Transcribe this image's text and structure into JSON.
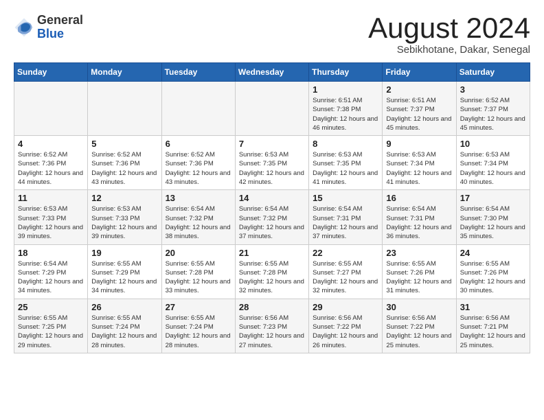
{
  "logo": {
    "general": "General",
    "blue": "Blue"
  },
  "header": {
    "month": "August 2024",
    "location": "Sebikhotane, Dakar, Senegal"
  },
  "weekdays": [
    "Sunday",
    "Monday",
    "Tuesday",
    "Wednesday",
    "Thursday",
    "Friday",
    "Saturday"
  ],
  "weeks": [
    [
      {
        "day": "",
        "info": ""
      },
      {
        "day": "",
        "info": ""
      },
      {
        "day": "",
        "info": ""
      },
      {
        "day": "",
        "info": ""
      },
      {
        "day": "1",
        "info": "Sunrise: 6:51 AM\nSunset: 7:38 PM\nDaylight: 12 hours and 46 minutes."
      },
      {
        "day": "2",
        "info": "Sunrise: 6:51 AM\nSunset: 7:37 PM\nDaylight: 12 hours and 45 minutes."
      },
      {
        "day": "3",
        "info": "Sunrise: 6:52 AM\nSunset: 7:37 PM\nDaylight: 12 hours and 45 minutes."
      }
    ],
    [
      {
        "day": "4",
        "info": "Sunrise: 6:52 AM\nSunset: 7:36 PM\nDaylight: 12 hours and 44 minutes."
      },
      {
        "day": "5",
        "info": "Sunrise: 6:52 AM\nSunset: 7:36 PM\nDaylight: 12 hours and 43 minutes."
      },
      {
        "day": "6",
        "info": "Sunrise: 6:52 AM\nSunset: 7:36 PM\nDaylight: 12 hours and 43 minutes."
      },
      {
        "day": "7",
        "info": "Sunrise: 6:53 AM\nSunset: 7:35 PM\nDaylight: 12 hours and 42 minutes."
      },
      {
        "day": "8",
        "info": "Sunrise: 6:53 AM\nSunset: 7:35 PM\nDaylight: 12 hours and 41 minutes."
      },
      {
        "day": "9",
        "info": "Sunrise: 6:53 AM\nSunset: 7:34 PM\nDaylight: 12 hours and 41 minutes."
      },
      {
        "day": "10",
        "info": "Sunrise: 6:53 AM\nSunset: 7:34 PM\nDaylight: 12 hours and 40 minutes."
      }
    ],
    [
      {
        "day": "11",
        "info": "Sunrise: 6:53 AM\nSunset: 7:33 PM\nDaylight: 12 hours and 39 minutes."
      },
      {
        "day": "12",
        "info": "Sunrise: 6:53 AM\nSunset: 7:33 PM\nDaylight: 12 hours and 39 minutes."
      },
      {
        "day": "13",
        "info": "Sunrise: 6:54 AM\nSunset: 7:32 PM\nDaylight: 12 hours and 38 minutes."
      },
      {
        "day": "14",
        "info": "Sunrise: 6:54 AM\nSunset: 7:32 PM\nDaylight: 12 hours and 37 minutes."
      },
      {
        "day": "15",
        "info": "Sunrise: 6:54 AM\nSunset: 7:31 PM\nDaylight: 12 hours and 37 minutes."
      },
      {
        "day": "16",
        "info": "Sunrise: 6:54 AM\nSunset: 7:31 PM\nDaylight: 12 hours and 36 minutes."
      },
      {
        "day": "17",
        "info": "Sunrise: 6:54 AM\nSunset: 7:30 PM\nDaylight: 12 hours and 35 minutes."
      }
    ],
    [
      {
        "day": "18",
        "info": "Sunrise: 6:54 AM\nSunset: 7:29 PM\nDaylight: 12 hours and 34 minutes."
      },
      {
        "day": "19",
        "info": "Sunrise: 6:55 AM\nSunset: 7:29 PM\nDaylight: 12 hours and 34 minutes."
      },
      {
        "day": "20",
        "info": "Sunrise: 6:55 AM\nSunset: 7:28 PM\nDaylight: 12 hours and 33 minutes."
      },
      {
        "day": "21",
        "info": "Sunrise: 6:55 AM\nSunset: 7:28 PM\nDaylight: 12 hours and 32 minutes."
      },
      {
        "day": "22",
        "info": "Sunrise: 6:55 AM\nSunset: 7:27 PM\nDaylight: 12 hours and 32 minutes."
      },
      {
        "day": "23",
        "info": "Sunrise: 6:55 AM\nSunset: 7:26 PM\nDaylight: 12 hours and 31 minutes."
      },
      {
        "day": "24",
        "info": "Sunrise: 6:55 AM\nSunset: 7:26 PM\nDaylight: 12 hours and 30 minutes."
      }
    ],
    [
      {
        "day": "25",
        "info": "Sunrise: 6:55 AM\nSunset: 7:25 PM\nDaylight: 12 hours and 29 minutes."
      },
      {
        "day": "26",
        "info": "Sunrise: 6:55 AM\nSunset: 7:24 PM\nDaylight: 12 hours and 28 minutes."
      },
      {
        "day": "27",
        "info": "Sunrise: 6:55 AM\nSunset: 7:24 PM\nDaylight: 12 hours and 28 minutes."
      },
      {
        "day": "28",
        "info": "Sunrise: 6:56 AM\nSunset: 7:23 PM\nDaylight: 12 hours and 27 minutes."
      },
      {
        "day": "29",
        "info": "Sunrise: 6:56 AM\nSunset: 7:22 PM\nDaylight: 12 hours and 26 minutes."
      },
      {
        "day": "30",
        "info": "Sunrise: 6:56 AM\nSunset: 7:22 PM\nDaylight: 12 hours and 25 minutes."
      },
      {
        "day": "31",
        "info": "Sunrise: 6:56 AM\nSunset: 7:21 PM\nDaylight: 12 hours and 25 minutes."
      }
    ]
  ]
}
